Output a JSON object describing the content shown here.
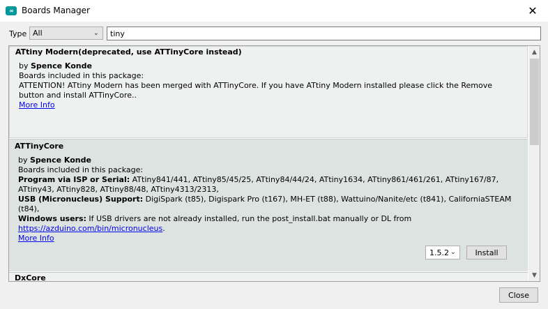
{
  "window": {
    "icon_text": "∞",
    "title": "Boards Manager",
    "close_glyph": "✕"
  },
  "toolbar": {
    "type_label": "Type",
    "type_value": "All",
    "search_value": "tiny"
  },
  "entries": [
    {
      "name": "ATtiny Modern(deprecated, use ATTinyCore instead)",
      "by_prefix": "by ",
      "author": "Spence Konde",
      "boards_text": "Boards included in this package:",
      "desc_line1": "ATTENTION! ATtiny Modern has been merged with ATTinyCore. If you have ATtiny Modern installed please click the Remove",
      "desc_line2": "button and install ATTinyCore..",
      "more_info": "More Info"
    },
    {
      "name": "ATTinyCore",
      "by_prefix": "by ",
      "author": "Spence Konde",
      "boards_text": "Boards included in this package:",
      "prog_label": "Program via ISP or Serial:",
      "prog_line1": " ATtiny841/441, ATtiny85/45/25, ATtiny84/44/24, ATtiny1634, ATtiny861/461/261, ATtiny167/87,",
      "prog_line2": "ATtiny43, ATtiny828, ATtiny88/48, ATtiny4313/2313,",
      "usb_label": "USB (Micronucleus) Support:",
      "usb_line1": " DigiSpark (t85), Digispark Pro (t167), MH-ET (t88), Wattuino/Nanite/etc (t841), CaliforniaSTEAM",
      "usb_line2": "(t84),",
      "win_label": "Windows users:",
      "win_line1": " If USB drivers are not already installed, run the post_install.bat manually or DL from",
      "win_link": "https://azduino.com/bin/micronucleus",
      "win_after_link": ".",
      "more_info": "More Info",
      "version": "1.5.2",
      "install_label": "Install"
    },
    {
      "name": "DxCore"
    }
  ],
  "footer": {
    "close_label": "Close"
  }
}
